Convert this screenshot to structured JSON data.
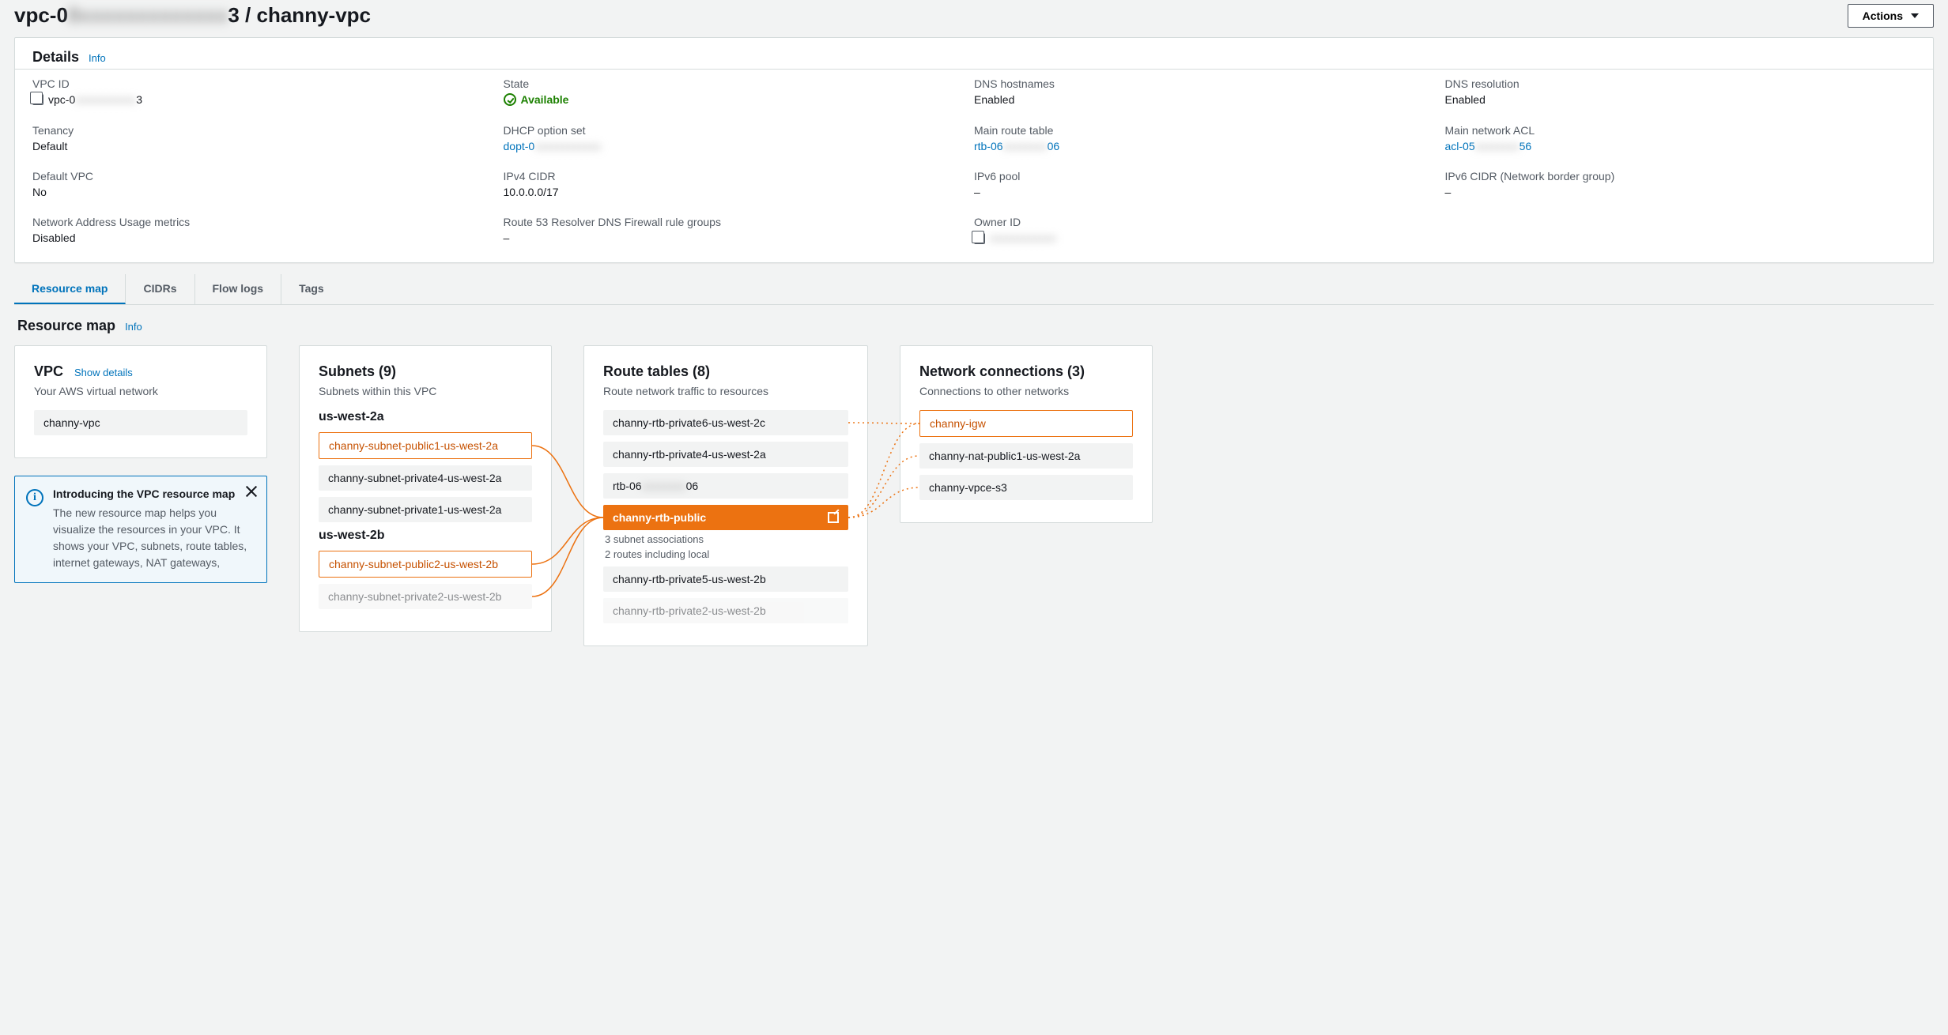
{
  "header": {
    "title_prefix": "vpc-0",
    "title_blurred": "8xxxxxxxxxxxxx",
    "title_suffix": "3 / channy-vpc",
    "actions_label": "Actions"
  },
  "details": {
    "title": "Details",
    "info": "Info",
    "cells": [
      {
        "label": "VPC ID",
        "value": "vpc-0",
        "blurred": "xxxxxxxxxxx",
        "suffix": "3",
        "copy": true
      },
      {
        "label": "State",
        "value": "Available",
        "status": true
      },
      {
        "label": "DNS hostnames",
        "value": "Enabled"
      },
      {
        "label": "DNS resolution",
        "value": "Enabled"
      },
      {
        "label": "Tenancy",
        "value": "Default"
      },
      {
        "label": "DHCP option set",
        "value": "dopt-0",
        "blurred": "xxxxxxxxxxxx",
        "link": true
      },
      {
        "label": "Main route table",
        "value": "rtb-06",
        "blurred": "xxxxxxxx",
        "suffix": "06",
        "link": true
      },
      {
        "label": "Main network ACL",
        "value": "acl-05",
        "blurred": "xxxxxxxx",
        "suffix": "56",
        "link": true
      },
      {
        "label": "Default VPC",
        "value": "No"
      },
      {
        "label": "IPv4 CIDR",
        "value": "10.0.0.0/17"
      },
      {
        "label": "IPv6 pool",
        "value": "–"
      },
      {
        "label": "IPv6 CIDR (Network border group)",
        "value": "–"
      },
      {
        "label": "Network Address Usage metrics",
        "value": "Disabled"
      },
      {
        "label": "Route 53 Resolver DNS Firewall rule groups",
        "value": "–"
      },
      {
        "label": "Owner ID",
        "value": "",
        "blurred": "xxxxxxxxxxxx",
        "copy": true
      }
    ]
  },
  "tabs": [
    "Resource map",
    "CIDRs",
    "Flow logs",
    "Tags"
  ],
  "active_tab": 0,
  "resource_map": {
    "title": "Resource map",
    "info": "Info",
    "vpc": {
      "title": "VPC",
      "show_details": "Show details",
      "subtitle": "Your AWS virtual network",
      "name": "channy-vpc",
      "alert": {
        "title": "Introducing the VPC resource map",
        "body": "The new resource map helps you visualize the resources in your VPC. It shows your VPC, subnets, route tables, internet gateways, NAT gateways,"
      }
    },
    "subnets": {
      "title": "Subnets (9)",
      "subtitle": "Subnets within this VPC",
      "groups": [
        {
          "az": "us-west-2a",
          "items": [
            {
              "name": "channy-subnet-public1-us-west-2a",
              "hl": true
            },
            {
              "name": "channy-subnet-private4-us-west-2a"
            },
            {
              "name": "channy-subnet-private1-us-west-2a"
            }
          ]
        },
        {
          "az": "us-west-2b",
          "items": [
            {
              "name": "channy-subnet-public2-us-west-2b",
              "hl": true
            },
            {
              "name": "channy-subnet-private2-us-west-2b",
              "partial": true
            }
          ]
        }
      ]
    },
    "route_tables": {
      "title": "Route tables (8)",
      "subtitle": "Route network traffic to resources",
      "items": [
        {
          "name": "channy-rtb-private6-us-west-2c"
        },
        {
          "name": "channy-rtb-private4-us-west-2a"
        },
        {
          "name": "rtb-06",
          "blurred": "xxxxxxxx",
          "suffix": "06"
        },
        {
          "name": "channy-rtb-public",
          "hl_fill": true,
          "sub1": "3 subnet associations",
          "sub2": "2 routes including local"
        },
        {
          "name": "channy-rtb-private5-us-west-2b"
        },
        {
          "name": "channy-rtb-private2-us-west-2b",
          "partial": true
        }
      ]
    },
    "network_connections": {
      "title": "Network connections (3)",
      "subtitle": "Connections to other networks",
      "items": [
        {
          "name": "channy-igw",
          "hl": true
        },
        {
          "name": "channy-nat-public1-us-west-2a"
        },
        {
          "name": "channy-vpce-s3"
        }
      ]
    }
  }
}
